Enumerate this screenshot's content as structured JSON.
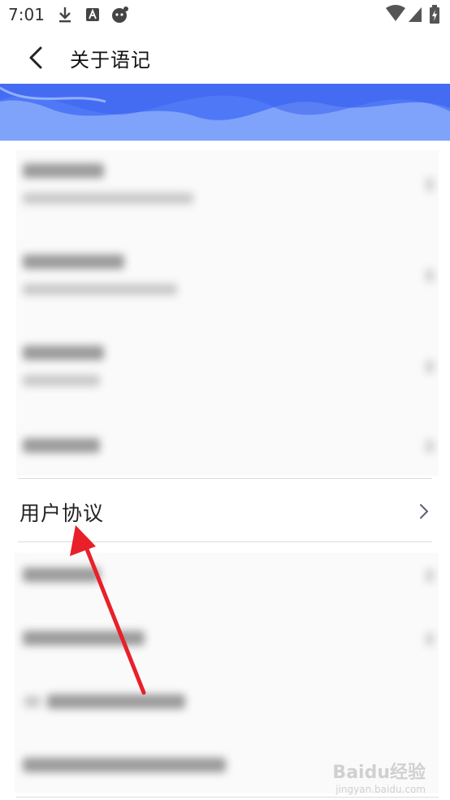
{
  "status_bar": {
    "time": "7:01",
    "icons": [
      "download-icon",
      "text-a-icon",
      "app-notification-icon",
      "wifi-icon",
      "signal-icon",
      "battery-icon"
    ]
  },
  "header": {
    "title": "关于语记",
    "back_icon": "chevron-left-icon"
  },
  "banner": {
    "colors": [
      "#7fa2fb",
      "#4f78f6",
      "#a8c1ff"
    ]
  },
  "list": {
    "user_agreement": {
      "label": "用户协议",
      "chevron_icon": "chevron-right-icon"
    }
  },
  "annotation": {
    "color": "#e8202a",
    "shape": "red-arrow-pointing-to-user-agreement"
  },
  "watermark": {
    "text": "Baidu经验",
    "subtext": "jingyan.baidu.com"
  }
}
